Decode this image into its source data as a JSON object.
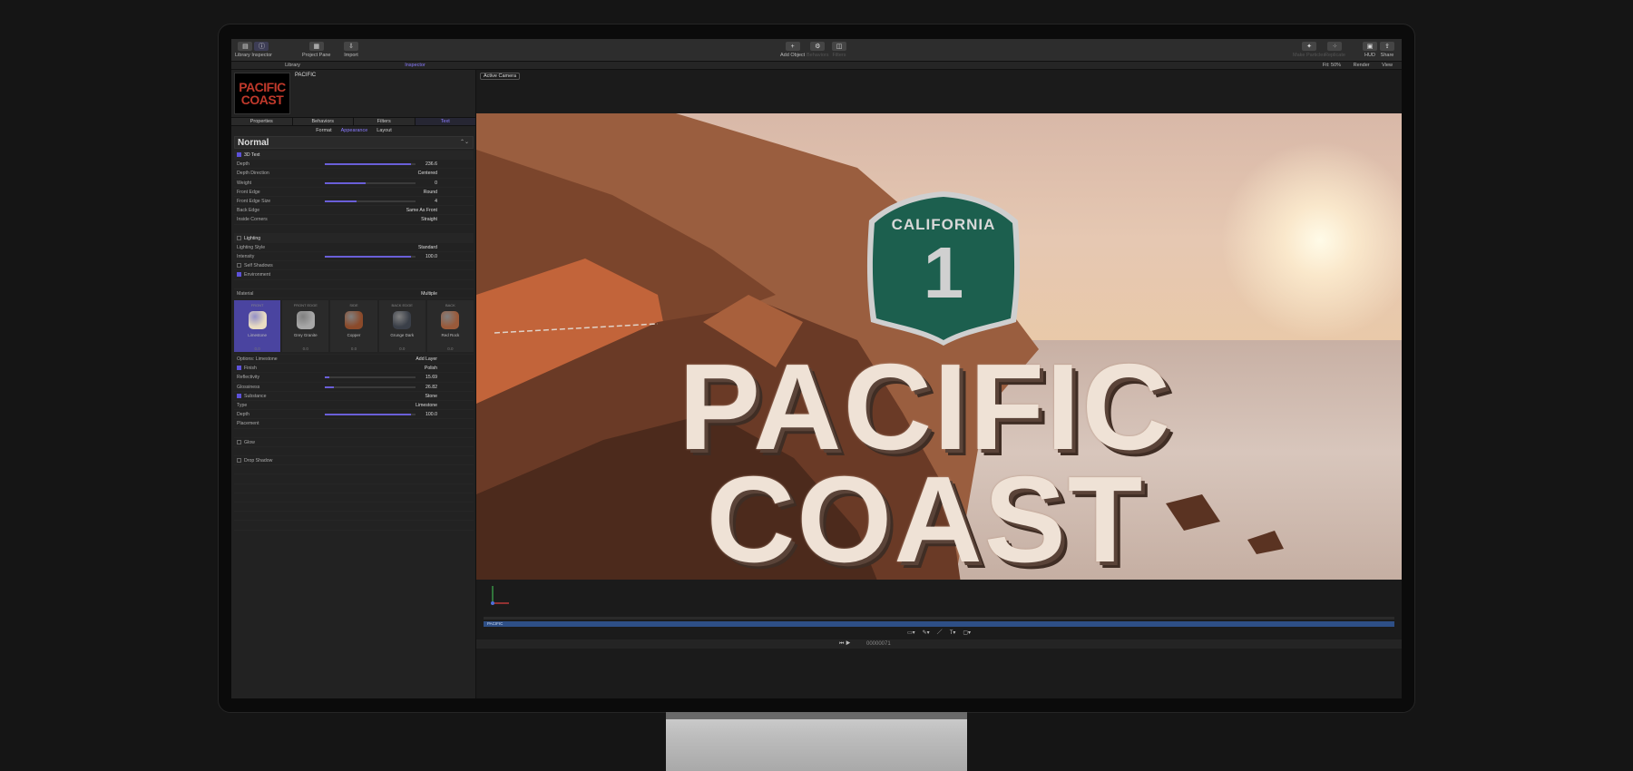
{
  "toolbar": {
    "left": [
      {
        "label": "Library"
      },
      {
        "label": "Inspector"
      }
    ],
    "project_pane": "Project Pane",
    "import": "Import",
    "add_object": "Add Object",
    "behaviors": "Behaviors",
    "filters": "Filters",
    "make_particles": "Make Particles",
    "replicate": "Replicate",
    "hud": "HUD",
    "share": "Share"
  },
  "panel_tabs": {
    "library": "Library",
    "inspector": "Inspector"
  },
  "canvas_bar": {
    "fit": "Fit: 50%",
    "render": "Render",
    "view": "View"
  },
  "object": {
    "name": "PACIFIC",
    "preview_line1": "PACIFIC",
    "preview_line2": "COAST"
  },
  "inspector_tabs": [
    {
      "label": "Properties",
      "active": false
    },
    {
      "label": "Behaviors",
      "active": false
    },
    {
      "label": "Filters",
      "active": false
    },
    {
      "label": "Text",
      "active": true
    }
  ],
  "subtabs": [
    {
      "label": "Format",
      "active": false
    },
    {
      "label": "Appearance",
      "active": true
    },
    {
      "label": "Layout",
      "active": false
    }
  ],
  "preset": "Normal",
  "rows_top": [
    {
      "label": "3D Text",
      "type": "section",
      "checked": true
    },
    {
      "label": "Depth",
      "value": "236.6",
      "slider": 0.95
    },
    {
      "label": "Depth Direction",
      "value": "Centered"
    },
    {
      "label": "Weight",
      "value": "0",
      "slider": 0.45
    },
    {
      "label": "Front Edge",
      "value": "Round"
    },
    {
      "label": "Front Edge Size",
      "value": "4",
      "slider": 0.35
    },
    {
      "label": "Back Edge",
      "value": "Same As Front"
    },
    {
      "label": "Inside Corners",
      "value": "Straight"
    },
    {
      "label": "",
      "value": ""
    },
    {
      "label": "Lighting",
      "type": "section"
    },
    {
      "label": "Lighting Style",
      "value": "Standard"
    },
    {
      "label": "Intensity",
      "value": "100.0",
      "slider": 0.95
    },
    {
      "label": "Self Shadows",
      "checked": false,
      "type": "check"
    },
    {
      "label": "Environment",
      "checked": true,
      "type": "check"
    },
    {
      "label": "",
      "value": ""
    },
    {
      "label": "Material",
      "value": "Multiple"
    }
  ],
  "materials": [
    {
      "header": "FRONT",
      "name": "Limestone",
      "num": "0.0",
      "color": "#e9dcc2",
      "active": true
    },
    {
      "header": "FRONT EDGE",
      "name": "Grey Granite",
      "num": "0.0",
      "color": "#a7a7a7",
      "active": false
    },
    {
      "header": "SIDE",
      "name": "Copper",
      "num": "0.0",
      "color": "#8b4a2a",
      "active": false
    },
    {
      "header": "BACK EDGE",
      "name": "Grunge Dark",
      "num": "0.0",
      "color": "#3a3f48",
      "active": false
    },
    {
      "header": "BACK",
      "name": "Red Rock",
      "num": "0.0",
      "color": "#9a5a3a",
      "active": false
    }
  ],
  "rows_bottom": [
    {
      "label": "Options: Limestone",
      "value": "Add Layer"
    },
    {
      "label": "Finish",
      "value": "Polish",
      "checked": true,
      "type": "check"
    },
    {
      "label": "Reflectivity",
      "value": "15.69",
      "slider": 0.05
    },
    {
      "label": "Glossiness",
      "value": "26.82",
      "slider": 0.1
    },
    {
      "label": "Substance",
      "value": "Stone",
      "checked": true,
      "type": "check"
    },
    {
      "label": "Type",
      "value": "Limestone"
    },
    {
      "label": "Depth",
      "value": "100.0",
      "slider": 0.95
    },
    {
      "label": "Placement",
      "value": ""
    },
    {
      "label": "",
      "value": ""
    },
    {
      "label": "Glow",
      "checked": false,
      "type": "check"
    },
    {
      "label": "",
      "value": ""
    },
    {
      "label": "Drop Shadow",
      "checked": false,
      "type": "check"
    }
  ],
  "camera": "Active Camera",
  "sign": {
    "state": "CALIFORNIA",
    "number": "1"
  },
  "title": {
    "line1": "PACIFIC",
    "line2": "COAST"
  },
  "timeline": {
    "layer": "PACIFIC",
    "timecode": "00000071"
  }
}
